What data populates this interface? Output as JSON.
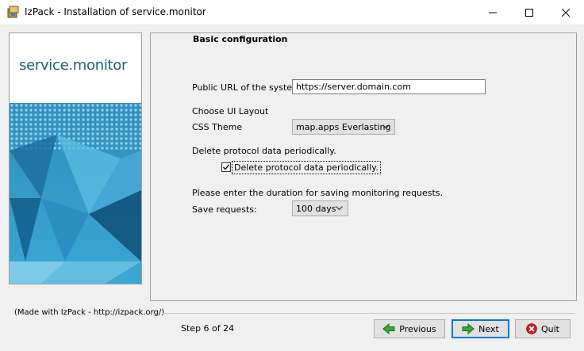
{
  "window": {
    "title": "IzPack - Installation of service.monitor",
    "app_icon": "izpack-icon",
    "controls": [
      "minimize-icon",
      "maximize-icon",
      "close-icon"
    ]
  },
  "sidebar": {
    "brand": "service.monitor"
  },
  "panel": {
    "section_title": "Basic configuration",
    "url_label": "Public URL of the system:",
    "url_value": "https://server.domain.com",
    "ui_layout_label": "Choose UI Layout",
    "css_theme_label": "CSS Theme",
    "css_theme_value": "map.apps Everlasting",
    "delete_label": "Delete protocol data periodically.",
    "delete_checkbox_label": "Delete protocol data periodically.",
    "delete_checked": true,
    "duration_label": "Please enter the duration for saving monitoring requests.",
    "save_requests_label": "Save requests:",
    "save_requests_value": "100 days"
  },
  "footer": {
    "made_with": "(Made with IzPack - http://izpack.org/)",
    "step": "Step 6 of 24",
    "previous_label": "Previous",
    "next_label": "Next",
    "quit_label": "Quit"
  },
  "colors": {
    "accent": "#0078d7",
    "brand": "#1b5c86",
    "previous_icon": "#3aa53a",
    "next_icon": "#3aa53a",
    "quit_icon": "#d42020"
  }
}
